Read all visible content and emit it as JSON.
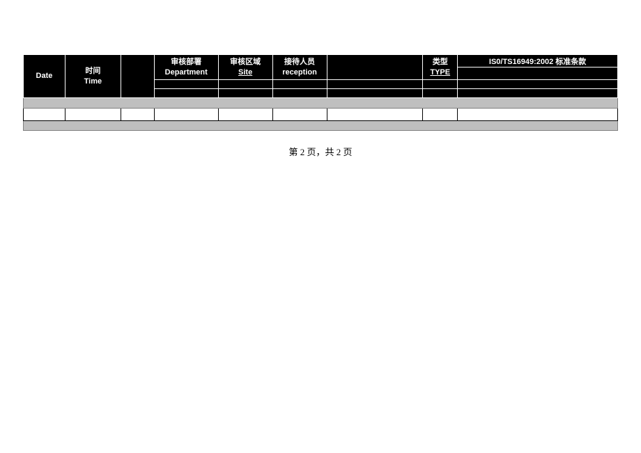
{
  "header": {
    "date": {
      "cn": "",
      "en": "Date"
    },
    "time": {
      "cn": "时间",
      "en": "Time"
    },
    "gap": {
      "cn": "",
      "en": ""
    },
    "department": {
      "cn": "审核部署",
      "en": "Department"
    },
    "site": {
      "cn": "审核区域",
      "en": "Site"
    },
    "reception": {
      "cn": "接待人员",
      "en": "reception"
    },
    "middle": {
      "cn": "",
      "en": ""
    },
    "type": {
      "cn": "类型",
      "en": "TYPE"
    },
    "iso": "IS0/TS16949:2002 标准条款"
  },
  "footer": {
    "page_text": "第 2 页，共 2 页"
  }
}
